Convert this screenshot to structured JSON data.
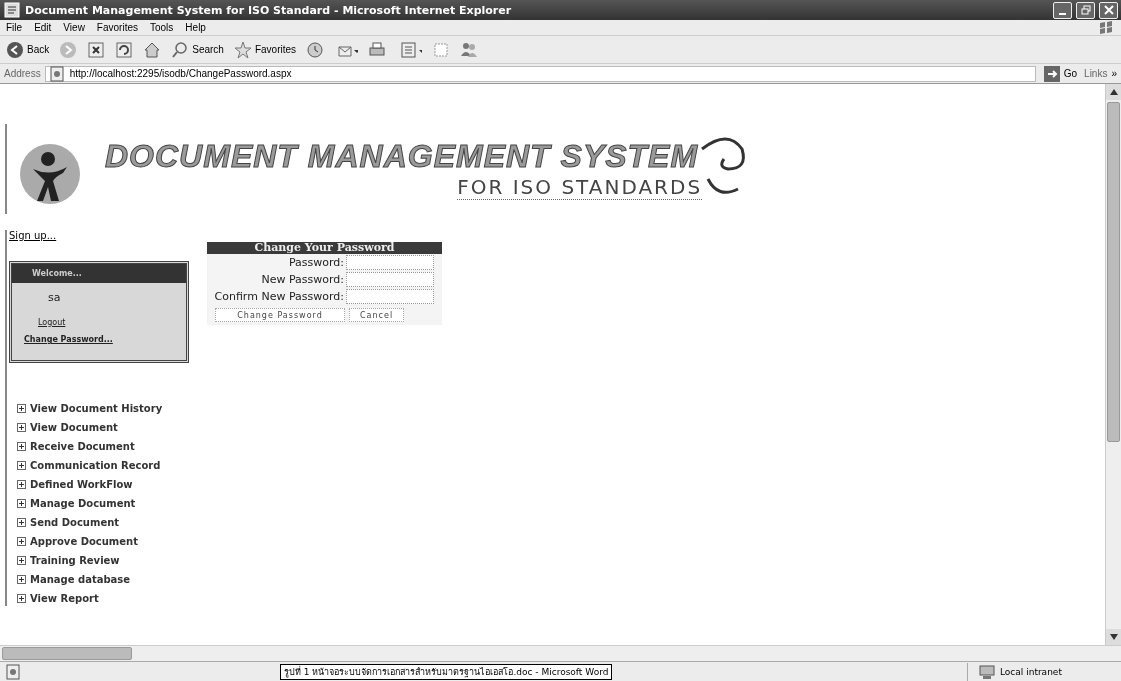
{
  "window": {
    "title": "Document Management System for ISO Standard - Microsoft Internet Explorer"
  },
  "menu": [
    "File",
    "Edit",
    "View",
    "Favorites",
    "Tools",
    "Help"
  ],
  "toolbar": [
    {
      "kind": "back",
      "label": "Back"
    },
    {
      "kind": "forward"
    },
    {
      "kind": "stop"
    },
    {
      "kind": "refresh"
    },
    {
      "kind": "home"
    },
    {
      "kind": "search",
      "label": "Search"
    },
    {
      "kind": "favorites",
      "label": "Favorites"
    },
    {
      "kind": "history"
    },
    {
      "kind": "mail"
    },
    {
      "kind": "print"
    },
    {
      "kind": "edit"
    },
    {
      "kind": "discuss"
    },
    {
      "kind": "messenger"
    }
  ],
  "address": {
    "label": "Address",
    "url": "http://localhost:2295/isodb/ChangePassword.aspx",
    "go": "Go",
    "links": "Links",
    "more": "»"
  },
  "banner": {
    "title": "DOCUMENT MANAGEMENT SYSTEM",
    "subtitle": "FOR ISO STANDARDS"
  },
  "sign_up": "Sign up...",
  "welcome": {
    "header": "Welcome...",
    "user": "sa",
    "links": [
      "Logout",
      "Change Password..."
    ]
  },
  "nav": [
    "View Document History",
    "View Document",
    "Receive Document",
    "Communication Record",
    "Defined WorkFlow",
    "Manage Document",
    "Send Document",
    "Approve Document",
    "Training Review",
    "Manage database",
    "View Report"
  ],
  "form": {
    "title": "Change Your Password",
    "fields": [
      {
        "label": "Password:"
      },
      {
        "label": "New Password:"
      },
      {
        "label": "Confirm New Password:"
      }
    ],
    "buttons": [
      "Change Password",
      "Cancel"
    ]
  },
  "status_bar": {
    "taskbar_item": "รูปที่ 1 หน้าจอระบบจัดการเอกสารสำหรับมาตรฐานไอเอสโอ.doc - Microsoft Word",
    "zone": "Local intranet"
  }
}
